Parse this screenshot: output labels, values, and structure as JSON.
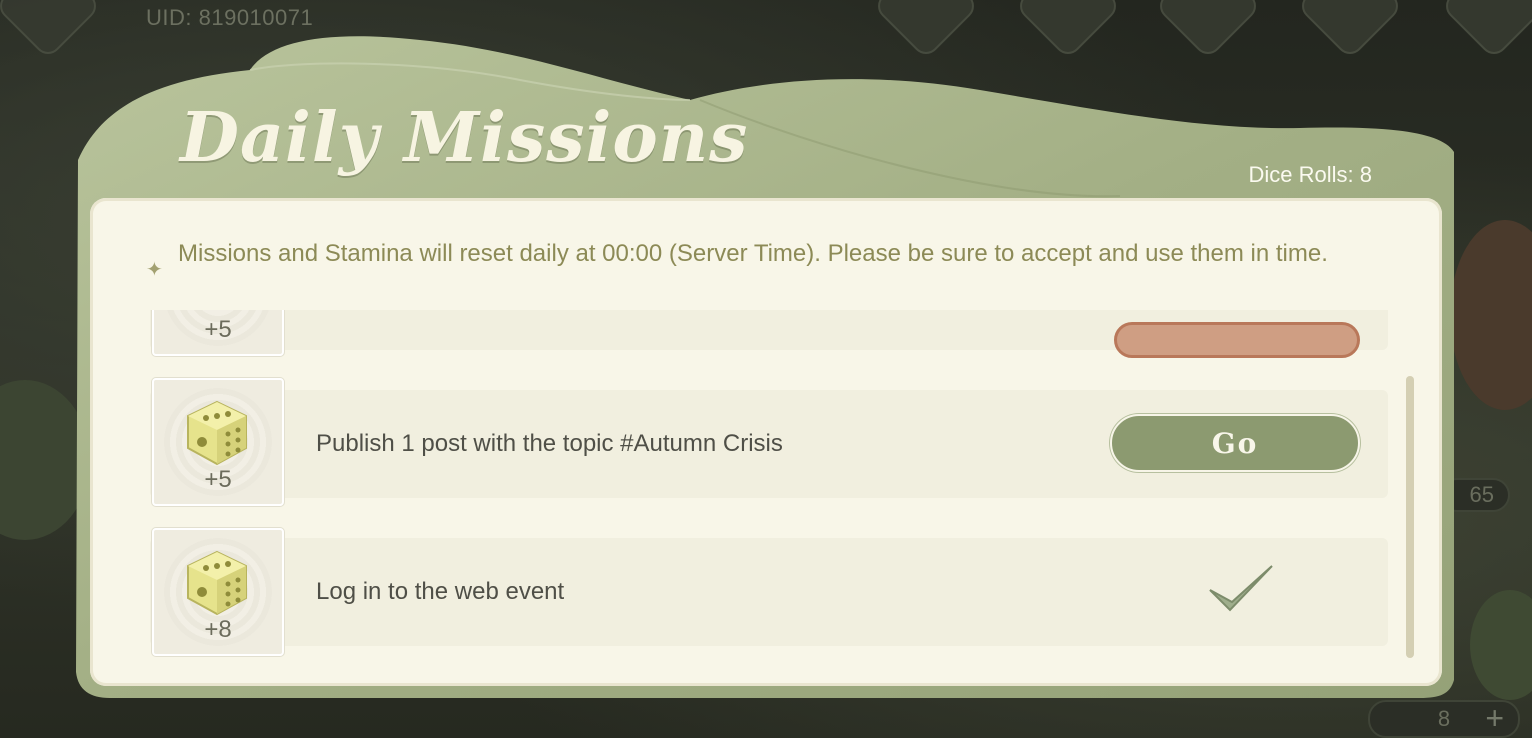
{
  "header": {
    "uid_text": "UID: 819010071",
    "title": "Daily Missions",
    "dice_rolls": "Dice Rolls: 8"
  },
  "notice": {
    "text": "Missions and Stamina will reset daily at 00:00 (Server Time). Please be sure to accept and use them in time."
  },
  "missions": [
    {
      "reward": "+5",
      "label": "",
      "state": "claim"
    },
    {
      "reward": "+5",
      "label": "Publish 1 post with the topic #Autumn Crisis",
      "state": "go",
      "button_label": "Go"
    },
    {
      "reward": "+8",
      "label": "Log in to the web event",
      "state": "completed"
    }
  ],
  "background": {
    "side_counter": "65",
    "bottom_counter": "8"
  },
  "colors": {
    "leaf_green": "#a6b288",
    "card_bg": "#f8f6e8",
    "go_button": "#8c9a70",
    "claim_button": "#cf9e83",
    "notice_text": "#8c8a56"
  }
}
